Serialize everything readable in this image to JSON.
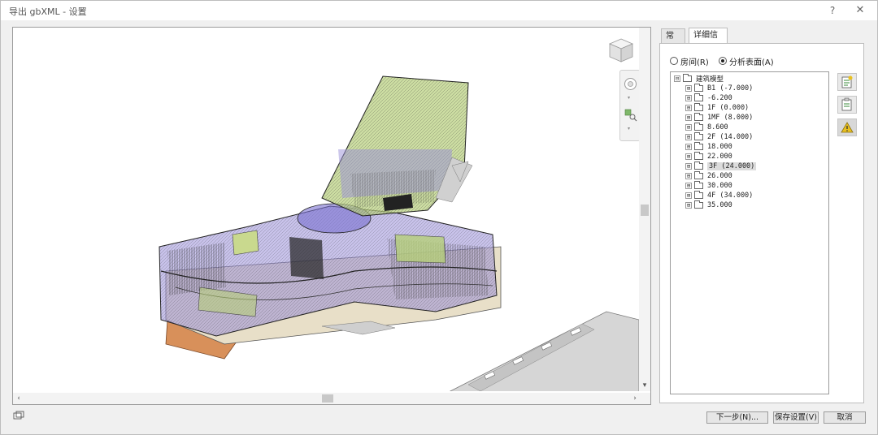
{
  "window": {
    "title": "导出 gbXML - 设置",
    "help_label": "?",
    "close_label": "✕"
  },
  "tabs": [
    {
      "label": "常规",
      "active": false
    },
    {
      "label": "详细信息",
      "active": true
    }
  ],
  "export_mode": {
    "options": [
      {
        "label": "房间(R)",
        "selected": false
      },
      {
        "label": "分析表面(A)",
        "selected": true
      }
    ]
  },
  "tree": {
    "root": {
      "label": "建筑模型",
      "expander": "⊟"
    },
    "items": [
      {
        "label": "B1 (-7.000)",
        "expander": "⊞"
      },
      {
        "label": "-6.200",
        "expander": "⊞"
      },
      {
        "label": "1F (0.000)",
        "expander": "⊞"
      },
      {
        "label": "1MF (8.000)",
        "expander": "⊞"
      },
      {
        "label": "8.600",
        "expander": "⊞"
      },
      {
        "label": "2F (14.000)",
        "expander": "⊞"
      },
      {
        "label": "18.000",
        "expander": "⊞"
      },
      {
        "label": "22.000",
        "expander": "⊞"
      },
      {
        "label": "3F (24.000)",
        "expander": "⊞",
        "selected": true
      },
      {
        "label": "26.000",
        "expander": "⊞"
      },
      {
        "label": "30.000",
        "expander": "⊞"
      },
      {
        "label": "4F (34.000)",
        "expander": "⊞"
      },
      {
        "label": "35.000",
        "expander": "⊞"
      }
    ]
  },
  "side_tools": [
    {
      "icon": "properties-icon"
    },
    {
      "icon": "paste-properties-icon"
    },
    {
      "icon": "warning-icon"
    }
  ],
  "buttons": {
    "next": "下一步(N)...",
    "save": "保存设置(V)",
    "cancel": "取消"
  },
  "scroll": {
    "left_arrow": "‹",
    "right_arrow": "›",
    "down_arrow": "▾"
  },
  "colors": {
    "model_purple": "#7a6fd0",
    "model_green": "#a8c86a",
    "model_orange": "#d8905a",
    "accent_warning": "#e8c020"
  }
}
